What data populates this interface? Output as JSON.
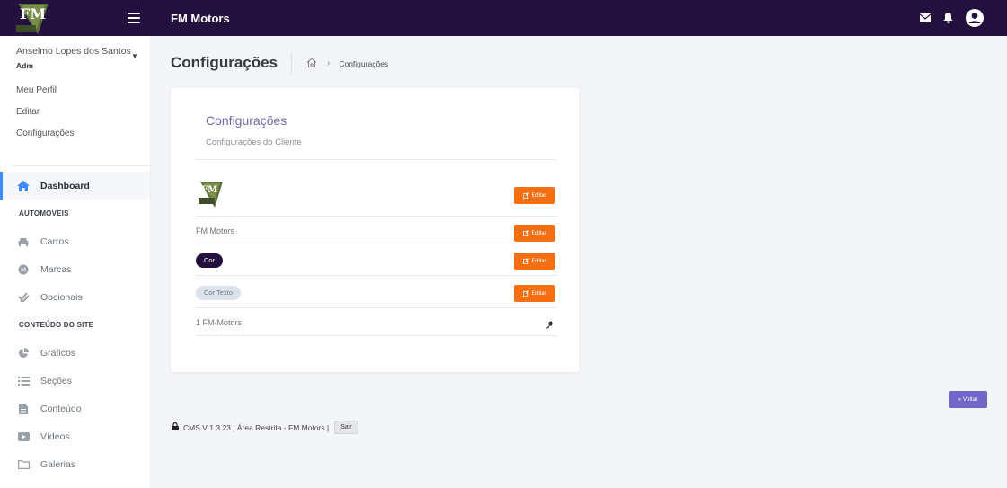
{
  "topbar": {
    "brand": "FM Motors",
    "logo_text": "FM",
    "colors": {
      "background": "#24103f"
    }
  },
  "sidebar": {
    "user": {
      "name": "Anselmo Lopes dos Santos",
      "role": "Adm"
    },
    "user_links": [
      "Meu Perfil",
      "Editar",
      "Configurações"
    ],
    "dashboard": "Dashboard",
    "section_auto": "AUTOMOVEIS",
    "auto_items": [
      {
        "label": "Carros",
        "icon": "car-icon"
      },
      {
        "label": "Marcas",
        "icon": "brand-icon"
      },
      {
        "label": "Opcionais",
        "icon": "check-double-icon"
      }
    ],
    "section_site": "CONTEÚDO DO SITE",
    "site_items": [
      {
        "label": "Gráficos",
        "icon": "pie-chart-icon"
      },
      {
        "label": "Seções",
        "icon": "list-icon"
      },
      {
        "label": "Conteúdo",
        "icon": "file-icon"
      },
      {
        "label": "Vídeos",
        "icon": "video-icon"
      },
      {
        "label": "Galerias",
        "icon": "folder-icon"
      }
    ]
  },
  "page": {
    "title": "Configurações",
    "breadcrumb_current": "Configurações"
  },
  "card": {
    "title": "Configurações",
    "subtitle": "Configurações do Cliente",
    "edit_label": "Editar",
    "rows": {
      "name": "FM Motors",
      "cor": {
        "label": "Cor",
        "color": "#24103f"
      },
      "cor_texto": {
        "label": "Cor Texto",
        "color": "#dde3ea"
      },
      "license": "1 FM-Motors"
    }
  },
  "actions": {
    "voltar": "« Voltar"
  },
  "footer": {
    "text": "CMS V 1.3.23 | Área Restrita - FM Motors |",
    "sair": "Sair"
  },
  "colors": {
    "accent_orange": "#f56f12",
    "accent_purple": "#7266c9",
    "active_blue": "#3d8bfd"
  }
}
